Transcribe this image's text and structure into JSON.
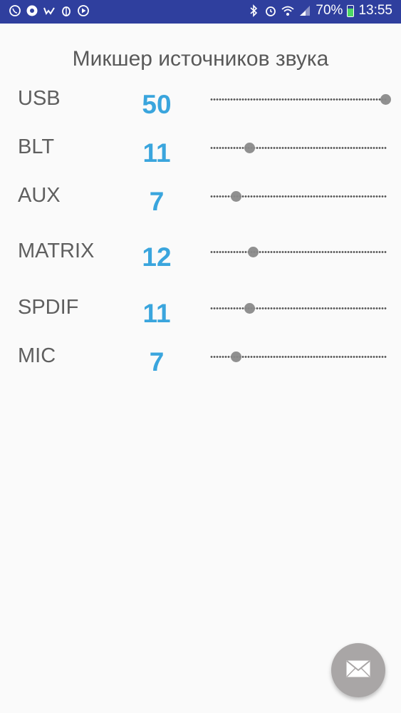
{
  "status_bar": {
    "battery": "70%",
    "battery_level": 0.7,
    "time": "13:55",
    "left_icons": [
      "viber-icon",
      "chrome-icon",
      "vk-icon",
      "bug-icon",
      "play-icon"
    ],
    "right_icons": [
      "bluetooth-icon",
      "alarm-icon",
      "wifi-icon",
      "signal-icon",
      "battery-icon"
    ]
  },
  "title": "Микшер источников звука",
  "channels": [
    {
      "label": "USB",
      "value": "50",
      "level": 1.0
    },
    {
      "label": "BLT",
      "value": "11",
      "level": 0.22
    },
    {
      "label": "AUX",
      "value": "7",
      "level": 0.14
    },
    {
      "label": "MATRIX",
      "value": "12",
      "level": 0.24
    },
    {
      "label": "SPDIF",
      "value": "11",
      "level": 0.22
    },
    {
      "label": "MIC",
      "value": "7",
      "level": 0.14
    }
  ],
  "fab": {
    "icon": "mail-icon"
  },
  "colors": {
    "status_bar": "#2f3f9e",
    "value_text": "#3aa5dd",
    "background": "#fafafa"
  }
}
